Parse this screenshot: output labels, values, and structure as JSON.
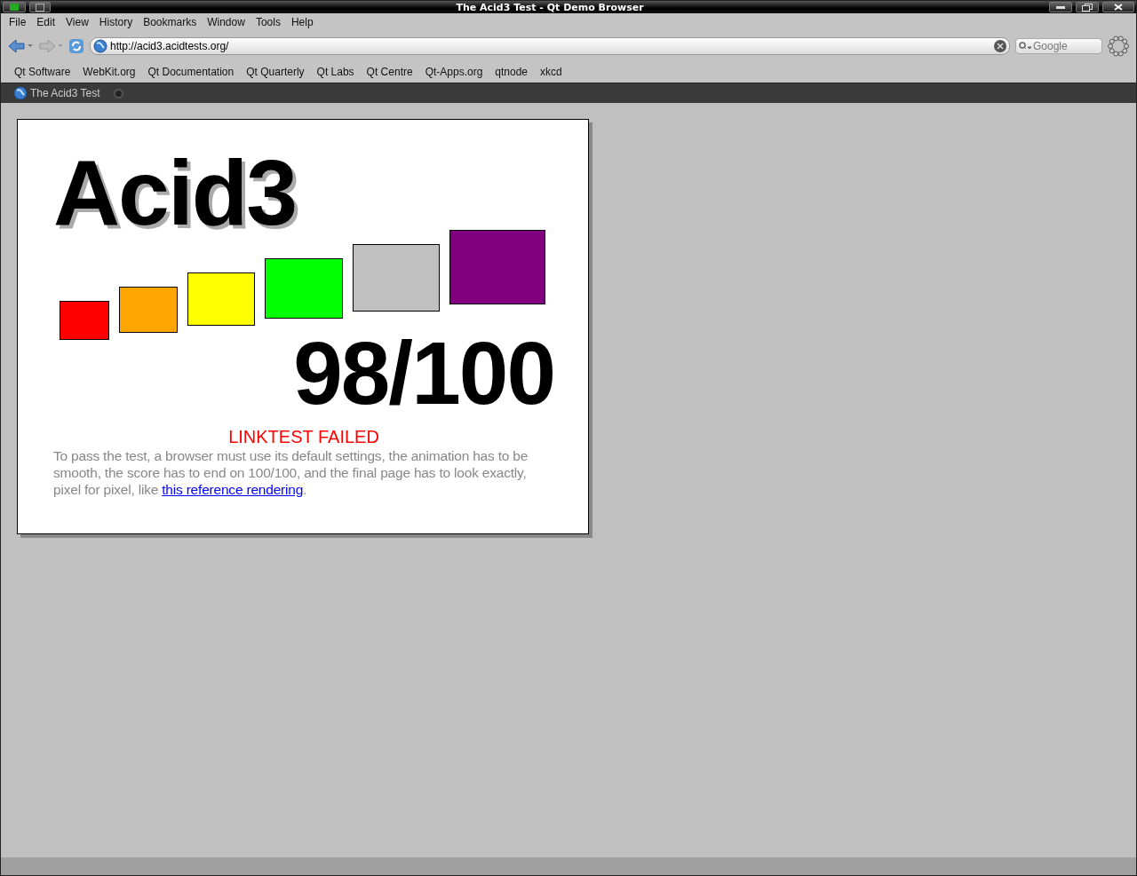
{
  "window": {
    "title": "The Acid3 Test - Qt Demo Browser"
  },
  "menu": [
    "File",
    "Edit",
    "View",
    "History",
    "Bookmarks",
    "Window",
    "Tools",
    "Help"
  ],
  "toolbar": {
    "url": "http://acid3.acidtests.org/",
    "search_placeholder": "Google"
  },
  "bookmarks": [
    "Qt Software",
    "WebKit.org",
    "Qt Documentation",
    "Qt Quarterly",
    "Qt Labs",
    "Qt Centre",
    "Qt-Apps.org",
    "qtnode",
    "xkcd"
  ],
  "tabs": [
    {
      "label": "The Acid3 Test",
      "selected": true
    }
  ],
  "page": {
    "heading": "Acid3",
    "boxes": [
      {
        "color": "#ff0000"
      },
      {
        "color": "#ffa500"
      },
      {
        "color": "#ffff00"
      },
      {
        "color": "#00ff00"
      },
      {
        "color": "#c0c0c0"
      },
      {
        "color": "#800080"
      }
    ],
    "score": "98/100",
    "status": "LINKTEST FAILED",
    "description": "To pass the test, a browser must use its default settings, the animation has to be smooth, the score has to end on 100/100, and the final page has to look exactly, pixel for pixel, like ",
    "link": "this reference rendering",
    "after_link": "."
  }
}
